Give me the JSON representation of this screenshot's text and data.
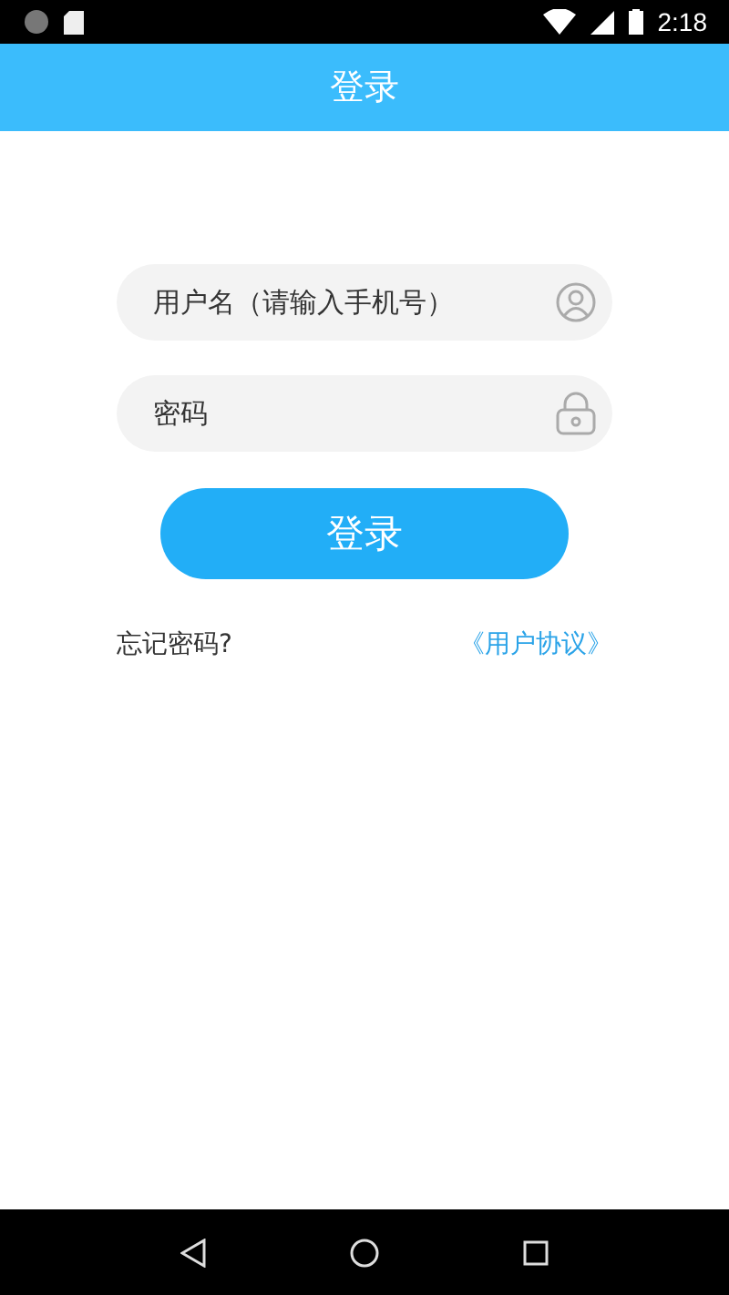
{
  "status_bar": {
    "time": "2:18"
  },
  "app_bar": {
    "title": "登录"
  },
  "form": {
    "username": {
      "placeholder": "用户名（请输入手机号）"
    },
    "password": {
      "placeholder": "密码"
    },
    "login_button": "登录",
    "forgot_link": "忘记密码?",
    "agreement_link": "《用户协议》"
  }
}
